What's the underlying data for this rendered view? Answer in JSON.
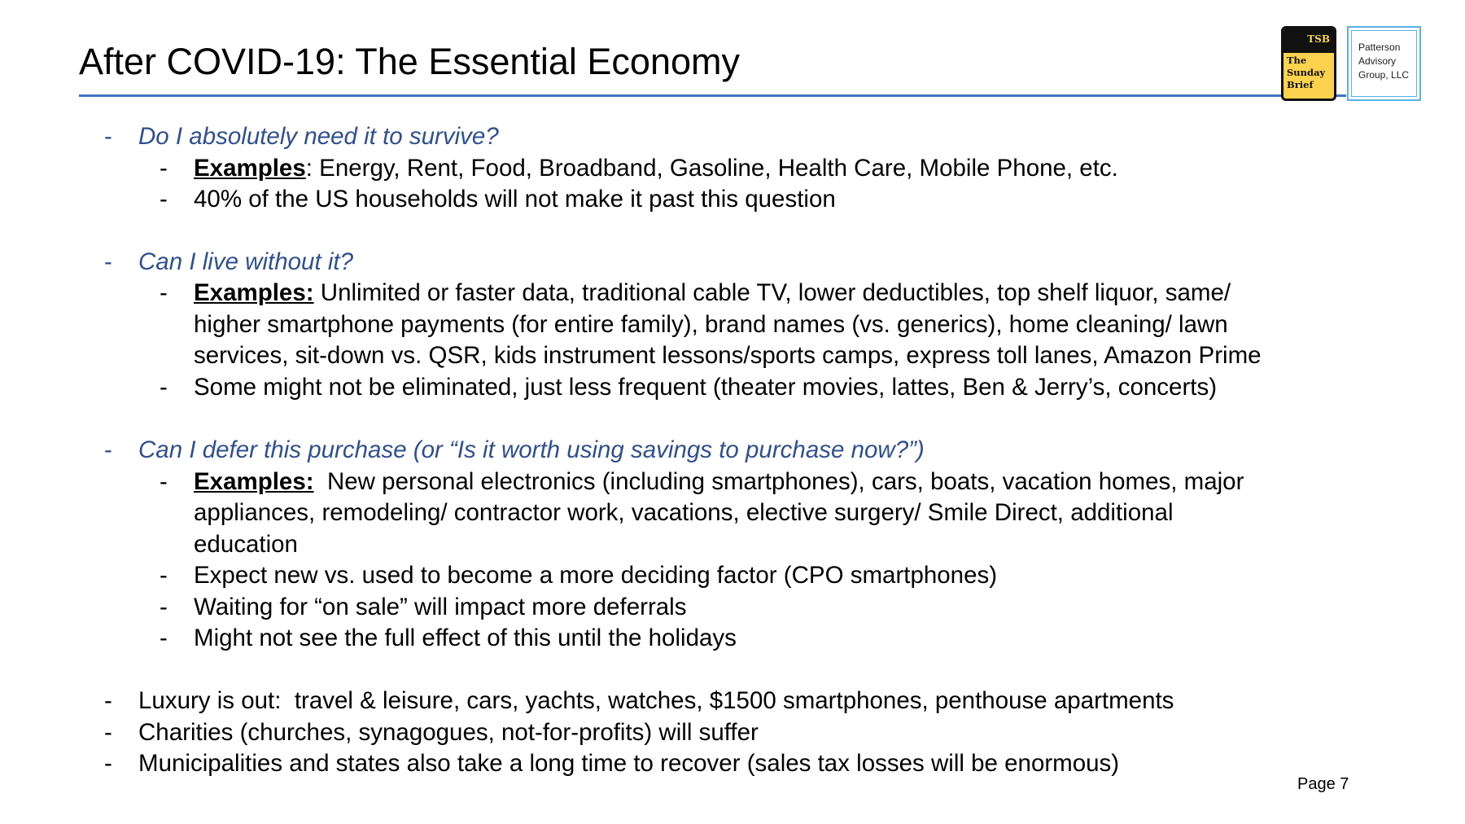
{
  "slide": {
    "title": "After COVID-19:  The Essential Economy",
    "page_label": "Page 7",
    "accent_color": "#4472c4",
    "question_color": "#2f4f8f"
  },
  "logos": {
    "tsb": {
      "abbr": "TSB",
      "line1": "The",
      "line2": "Sunday",
      "line3": "Brief"
    },
    "patterson": {
      "line1": "Patterson",
      "line2": "Advisory",
      "line3": "Group, LLC"
    }
  },
  "sections": [
    {
      "question": "Do I absolutely need it to survive?",
      "examples_label": "Examples",
      "examples_suffix": ": Energy, Rent, Food, Broadband, Gasoline, Health Care, Mobile Phone, etc.",
      "bullets": [
        "40% of the US households will not make it past this question"
      ]
    },
    {
      "question": "Can I live without it?",
      "examples_label": "Examples:",
      "examples_lines": [
        " Unlimited or faster data, traditional cable TV, lower deductibles, top shelf liquor, same/",
        "higher smartphone payments (for entire family), brand names (vs. generics), home cleaning/ lawn",
        "services, sit-down vs. QSR, kids instrument lessons/sports camps, express toll lanes, Amazon Prime"
      ],
      "bullets": [
        "Some might not be eliminated, just less frequent (theater movies, lattes, Ben & Jerry’s, concerts)"
      ]
    },
    {
      "question": "Can I defer this purchase (or “Is it worth using savings to purchase now?”)",
      "examples_label": "Examples:",
      "examples_lines": [
        "  New personal electronics (including smartphones), cars, boats, vacation homes, major",
        "appliances, remodeling/ contractor work, vacations, elective surgery/ Smile Direct, additional",
        "education"
      ],
      "bullets": [
        "Expect new vs. used to become a more deciding factor (CPO smartphones)",
        "Waiting for “on sale” will impact more deferrals",
        "Might not see the full effect of this until the holidays"
      ]
    }
  ],
  "closing_bullets": [
    "Luxury is out:  travel & leisure, cars, yachts, watches, $1500 smartphones, penthouse apartments",
    "Charities (churches, synagogues, not-for-profits) will suffer",
    "Municipalities and states also take a long time to recover (sales tax losses will be enormous)"
  ],
  "dash": "-"
}
